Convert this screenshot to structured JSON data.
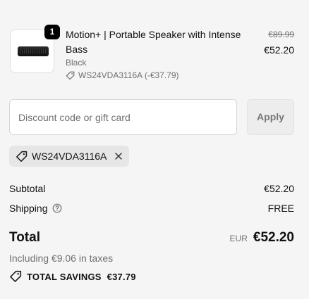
{
  "product": {
    "quantity": "1",
    "title": "Motion+ | Portable Speaker with Intense Bass",
    "variant": "Black",
    "discount_line": "WS24VDA3116A (-€37.79)",
    "original_price": "€89.99",
    "price": "€52.20"
  },
  "discount": {
    "placeholder": "Discount code or gift card",
    "value": "",
    "apply_label": "Apply",
    "applied_code": "WS24VDA3116A"
  },
  "summary": {
    "subtotal_label": "Subtotal",
    "subtotal_value": "€52.20",
    "shipping_label": "Shipping",
    "shipping_value": "FREE",
    "total_label": "Total",
    "currency": "EUR",
    "total_value": "€52.20",
    "taxes_text": "Including €9.06 in taxes",
    "savings_label": "TOTAL SAVINGS",
    "savings_value": "€37.79"
  },
  "colors": {
    "background": "#f5f5f5",
    "text": "#1a1a1a",
    "muted": "#707070",
    "badge": "#000000"
  },
  "icons": {
    "discount_tag": "tag-icon",
    "shipping_help": "help-circle-icon",
    "remove_code": "close-icon",
    "savings": "savings-tag-icon"
  }
}
